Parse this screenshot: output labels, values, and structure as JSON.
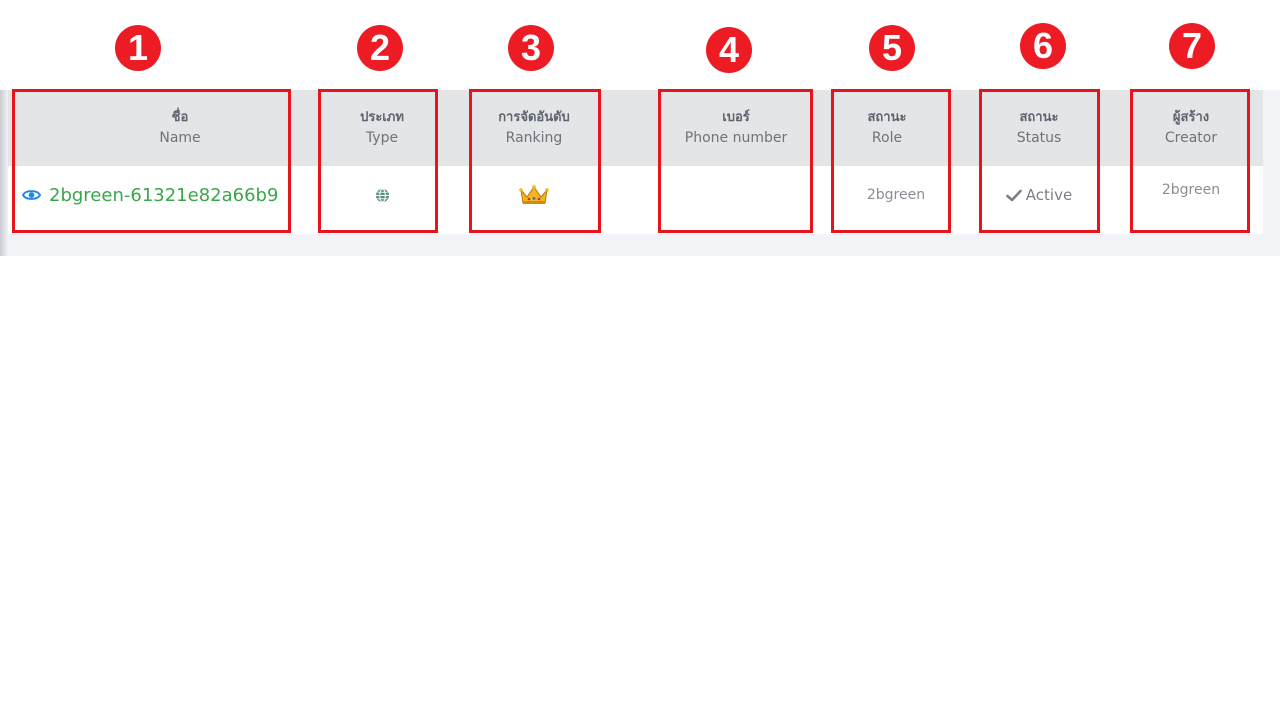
{
  "table": {
    "columns": [
      {
        "thai": "ชื่อ",
        "en": "Name"
      },
      {
        "thai": "ประเภท",
        "en": "Type"
      },
      {
        "thai": "การจัดอันดับ",
        "en": "Ranking"
      },
      {
        "thai": "เบอร์",
        "en": "Phone number"
      },
      {
        "thai": "สถานะ",
        "en": "Role"
      },
      {
        "thai": "สถานะ",
        "en": "Status"
      },
      {
        "thai": "ผู้สร้าง",
        "en": "Creator"
      }
    ],
    "rows": [
      {
        "name": "2bgreen-61321e82a66b9",
        "type_icon": "globe-icon",
        "ranking_icon": "crown-icon",
        "phone": "",
        "role": "2bgreen",
        "status": "Active",
        "status_icon": "check-icon",
        "creator": "2bgreen"
      }
    ]
  },
  "annotations": {
    "markers": [
      "1",
      "2",
      "3",
      "4",
      "5",
      "6",
      "7"
    ],
    "color": "#ed1c24"
  },
  "colors": {
    "header_bg": "#e4e5e7",
    "name_link": "#3aa64a",
    "eye_icon": "#1e88e5",
    "highlight": "#e8141b"
  }
}
